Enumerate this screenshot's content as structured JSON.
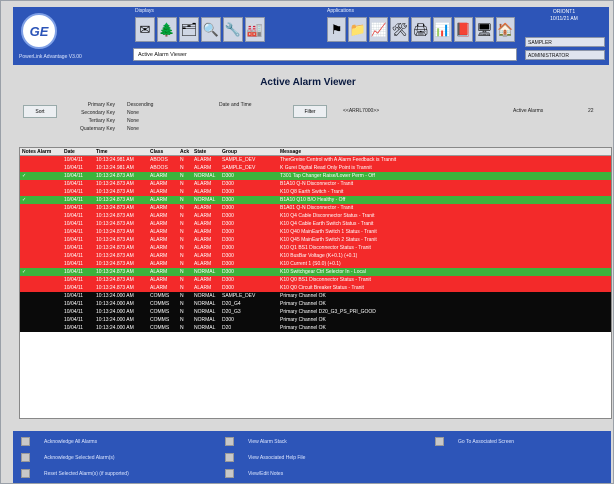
{
  "header": {
    "product": "PowerLink Advantage V3.00",
    "display_label": "Displays",
    "applications_label": "Applications",
    "logo": "GE",
    "date_title": "ORIONT1",
    "date_value": "10/11/21 AM",
    "user": "SAMPLER",
    "role": "ADMINISTRATOR",
    "screen_title": "Active Alarm Viewer",
    "display_icons": [
      "✉",
      "🌲",
      "🗂",
      "🔍",
      "🔧",
      "🏭"
    ],
    "app_icons": [
      "⚑",
      "📁",
      "📈",
      "🛠",
      "🖨",
      "📊",
      "📕",
      "🖥",
      "🏠"
    ]
  },
  "main": {
    "title": "Active Alarm Viewer",
    "sort_button": "Sort",
    "sort_keys": [
      {
        "k": "Primary Key",
        "v": "Descending"
      },
      {
        "k": "Secondary Key",
        "v": "None"
      },
      {
        "k": "Tertiary Key",
        "v": "None"
      },
      {
        "k": "Quaternary Key",
        "v": "None"
      }
    ],
    "date_time_hdr": "Date and Time",
    "filter_button": "Filter",
    "filter_text": "<<ARRL7000>>",
    "active_alarms_label": "Active Alarms",
    "active_alarms_value": "22"
  },
  "table": {
    "headers": [
      "Notes Alarm",
      "Date",
      "Time",
      "Class",
      "Ack",
      "State",
      "Group",
      "Message"
    ],
    "rows": [
      {
        "status": "red",
        "ack": "",
        "date": "10/04/11",
        "time": "10:13:24.981 AM",
        "class": "ABOOS",
        "a": "N",
        "state": "ALARM",
        "group": "SAMPLE_DEV",
        "msg": "TherGreise Centrol with A Alarm Feedback is Trannit"
      },
      {
        "status": "red",
        "ack": "",
        "date": "10/04/11",
        "time": "10:13:24.981 AM",
        "class": "ABOOS",
        "a": "N",
        "state": "ALARM",
        "group": "SAMPLE_DEV",
        "msg": "K Gurei Digital Read Only Point is Trannit"
      },
      {
        "status": "green",
        "ack": "✓",
        "date": "10/04/11",
        "time": "10:13:24.873 AM",
        "class": "ALARM",
        "a": "N",
        "state": "NORMAL",
        "group": "D300",
        "msg": "T301 Tap Changer Raise/Lower Perm - Off"
      },
      {
        "status": "red",
        "ack": "",
        "date": "10/04/11",
        "time": "10:13:24.873 AM",
        "class": "ALARM",
        "a": "N",
        "state": "ALARM",
        "group": "D300",
        "msg": "B1A10 Q-N Disconnector - Tranit"
      },
      {
        "status": "red",
        "ack": "",
        "date": "10/04/11",
        "time": "10:13:24.873 AM",
        "class": "ALARM",
        "a": "N",
        "state": "ALARM",
        "group": "D300",
        "msg": "K10 Q8 Earth Switch - Tranit"
      },
      {
        "status": "green",
        "ack": "✓",
        "date": "10/04/11",
        "time": "10:13:24.873 AM",
        "class": "ALARM",
        "a": "N",
        "state": "NORMAL",
        "group": "D300",
        "msg": "B1A10 Q10 B/O Healthy - Off"
      },
      {
        "status": "red",
        "ack": "",
        "date": "10/04/11",
        "time": "10:13:24.873 AM",
        "class": "ALARM",
        "a": "N",
        "state": "ALARM",
        "group": "D300",
        "msg": "B1A01 Q-N Disconnector - Tranit"
      },
      {
        "status": "red",
        "ack": "",
        "date": "10/04/11",
        "time": "10:13:24.873 AM",
        "class": "ALARM",
        "a": "N",
        "state": "ALARM",
        "group": "D300",
        "msg": "K10 Q4 Cable Disconnector Status - Tranit"
      },
      {
        "status": "red",
        "ack": "",
        "date": "10/04/11",
        "time": "10:13:24.873 AM",
        "class": "ALARM",
        "a": "N",
        "state": "ALARM",
        "group": "D300",
        "msg": "K10 Q4 Cable Earth Switch Status - Tranit"
      },
      {
        "status": "red",
        "ack": "",
        "date": "10/04/11",
        "time": "10:13:24.873 AM",
        "class": "ALARM",
        "a": "N",
        "state": "ALARM",
        "group": "D300",
        "msg": "K10 Q40 MainEarth Switch 1 Status - Tranit"
      },
      {
        "status": "red",
        "ack": "",
        "date": "10/04/11",
        "time": "10:13:24.873 AM",
        "class": "ALARM",
        "a": "N",
        "state": "ALARM",
        "group": "D300",
        "msg": "K10 Q45 MainEarth Switch 2 Status - Tranit"
      },
      {
        "status": "red",
        "ack": "",
        "date": "10/04/11",
        "time": "10:13:24.873 AM",
        "class": "ALARM",
        "a": "N",
        "state": "ALARM",
        "group": "D300",
        "msg": "K10 Q1 BS1 Disconnector Status - Tranit"
      },
      {
        "status": "red",
        "ack": "",
        "date": "10/04/11",
        "time": "10:13:24.873 AM",
        "class": "ALARM",
        "a": "N",
        "state": "ALARM",
        "group": "D300",
        "msg": "K10 BusBar Voltage (K+0.1) (+0.1)"
      },
      {
        "status": "red",
        "ack": "",
        "date": "10/04/11",
        "time": "10:13:24.873 AM",
        "class": "ALARM",
        "a": "N",
        "state": "ALARM",
        "group": "D300",
        "msg": "K10 Current 1 (S0.0) (+0.1)"
      },
      {
        "status": "green",
        "ack": "✓",
        "date": "10/04/11",
        "time": "10:13:24.873 AM",
        "class": "ALARM",
        "a": "N",
        "state": "NORMAL",
        "group": "D300",
        "msg": "K10 Switchgear Ctrl Selector In - Local"
      },
      {
        "status": "red",
        "ack": "",
        "date": "10/04/11",
        "time": "10:13:24.873 AM",
        "class": "ALARM",
        "a": "N",
        "state": "ALARM",
        "group": "D300",
        "msg": "K10 Q0 BS1 Disconnector Status - Tranit"
      },
      {
        "status": "red",
        "ack": "",
        "date": "10/04/11",
        "time": "10:13:24.873 AM",
        "class": "ALARM",
        "a": "N",
        "state": "ALARM",
        "group": "D300",
        "msg": "K10 Q0 Circuit Breaker Status - Tranit"
      },
      {
        "status": "black",
        "ack": "",
        "date": "10/04/11",
        "time": "10:13:24.000 AM",
        "class": "COMMS",
        "a": "N",
        "state": "NORMAL",
        "group": "SAMPLE_DEV",
        "msg": "Primary Channel OK"
      },
      {
        "status": "black",
        "ack": "",
        "date": "10/04/11",
        "time": "10:13:24.000 AM",
        "class": "COMMS",
        "a": "N",
        "state": "NORMAL",
        "group": "D20_G4",
        "msg": "Primary Channel OK"
      },
      {
        "status": "black",
        "ack": "",
        "date": "10/04/11",
        "time": "10:13:24.000 AM",
        "class": "COMMS",
        "a": "N",
        "state": "NORMAL",
        "group": "D20_G3",
        "msg": "Primary Channel D20_G3_PS_PRI_GOOD"
      },
      {
        "status": "black",
        "ack": "",
        "date": "10/04/11",
        "time": "10:13:24.000 AM",
        "class": "COMMS",
        "a": "N",
        "state": "NORMAL",
        "group": "D300",
        "msg": "Primary Channel OK"
      },
      {
        "status": "black",
        "ack": "",
        "date": "10/04/11",
        "time": "10:13:24.000 AM",
        "class": "COMMS",
        "a": "N",
        "state": "NORMAL",
        "group": "D20",
        "msg": "Primary Channel OK"
      }
    ]
  },
  "footer": {
    "ack_all": "Acknowledge All Alarms",
    "ack_selected": "Acknowledge Selected Alarm(s)",
    "reset_selected": "Reset Selected Alarm(s) (if supported)",
    "view_alarm_stack": "View Alarm Stack",
    "view_help": "View Associated Help File",
    "view_notes": "View/Edit Notes",
    "goto_screen": "Go To Associated Screen"
  }
}
